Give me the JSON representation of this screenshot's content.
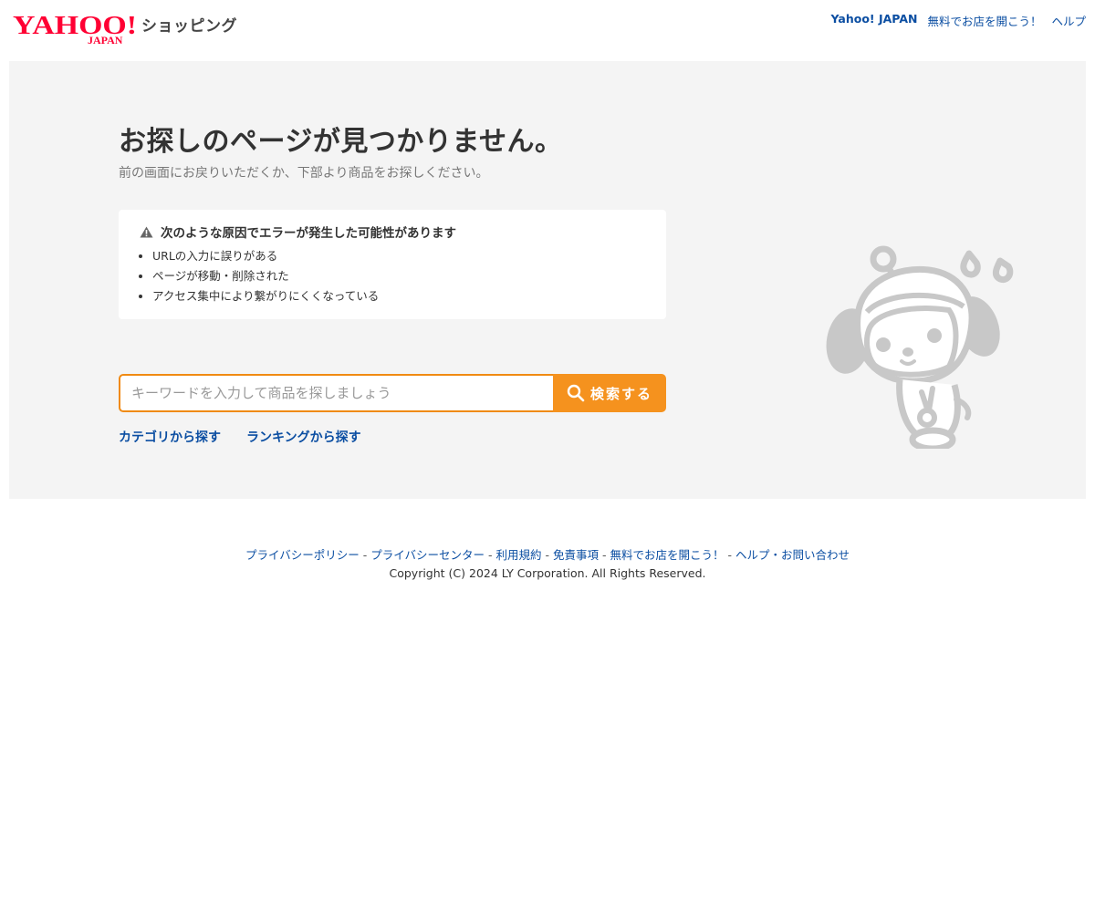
{
  "header": {
    "logo": {
      "brand": "YAHOO!",
      "sub": "JAPAN",
      "service": "ショッピング"
    },
    "links": [
      "Yahoo! JAPAN",
      "無料でお店を開こう！",
      "ヘルプ"
    ]
  },
  "main": {
    "title": "お探しのページが見つかりません。",
    "subtitle": "前の画面にお戻りいただくか、下部より商品をお探しください。",
    "error_box": {
      "heading": "次のような原因でエラーが発生した可能性があります",
      "reasons": [
        "URLの入力に誤りがある",
        "ページが移動・削除された",
        "アクセス集中により繋がりにくくなっている"
      ]
    },
    "search": {
      "placeholder": "キーワードを入力して商品を探しましょう",
      "button_label": "検索する"
    },
    "links": [
      "カテゴリから探す",
      "ランキングから探す"
    ]
  },
  "footer": {
    "links": [
      "プライバシーポリシー",
      "プライバシーセンター",
      "利用規約",
      "免責事項",
      "無料でお店を開こう！",
      "ヘルプ・お問い合わせ"
    ],
    "separator": " - ",
    "copyright": "Copyright (C) 2024 LY Corporation. All Rights Reserved."
  },
  "colors": {
    "brand_red": "#ff0033",
    "accent_orange": "#f5921e",
    "link_blue": "#0b4ea2",
    "panel_gray": "#f4f4f4"
  },
  "icons": [
    "warning-icon",
    "search-icon",
    "mascot-illustration"
  ]
}
